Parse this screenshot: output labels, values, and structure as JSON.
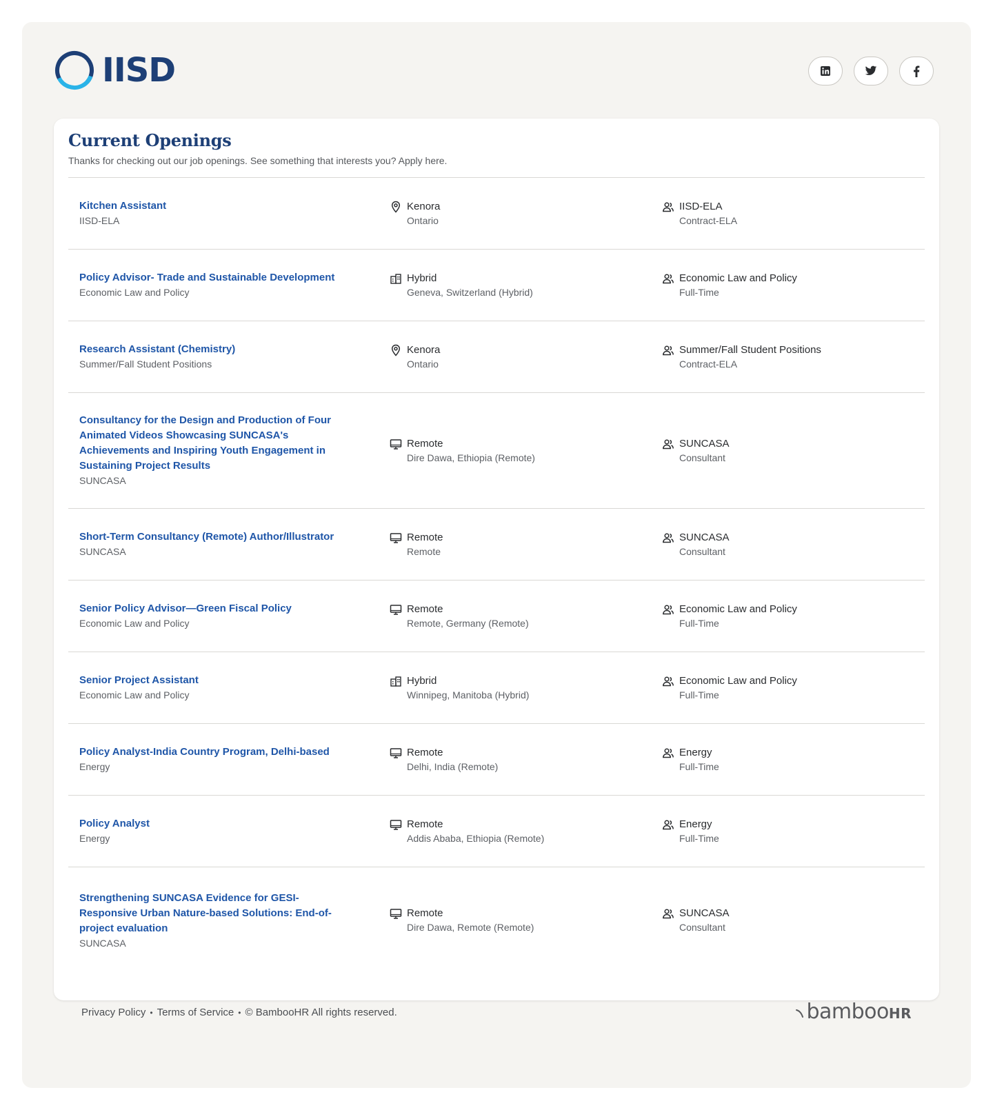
{
  "brand": {
    "name": "IISD"
  },
  "social": [
    {
      "name": "linkedin-icon"
    },
    {
      "name": "twitter-icon"
    },
    {
      "name": "facebook-icon"
    }
  ],
  "header": {
    "title": "Current Openings",
    "subtitle": "Thanks for checking out our job openings. See something that interests you? Apply here."
  },
  "jobs": [
    {
      "title_lines": [
        "Kitchen Assistant"
      ],
      "department": "IISD-ELA",
      "location_icon": "location-pin-icon",
      "location_type": "Kenora",
      "location_detail": "Ontario",
      "team": "IISD-ELA",
      "employment": "Contract-ELA"
    },
    {
      "title_lines": [
        "Policy Advisor- Trade and Sustainable Development"
      ],
      "department": "Economic Law and Policy",
      "location_icon": "hybrid-building-icon",
      "location_type": "Hybrid",
      "location_detail": "Geneva, Switzerland (Hybrid)",
      "team": "Economic Law and Policy",
      "employment": "Full-Time"
    },
    {
      "title_lines": [
        "Research Assistant (Chemistry)"
      ],
      "department": "Summer/Fall Student Positions",
      "location_icon": "location-pin-icon",
      "location_type": "Kenora",
      "location_detail": "Ontario",
      "team": "Summer/Fall Student Positions",
      "employment": "Contract-ELA"
    },
    {
      "title_lines": [
        "Consultancy for the Design and Production of Four",
        "Animated Videos Showcasing SUNCASA's",
        "Achievements and Inspiring Youth Engagement in",
        "Sustaining Project Results"
      ],
      "department": "SUNCASA",
      "location_icon": "remote-monitor-icon",
      "location_type": "Remote",
      "location_detail": "Dire Dawa, Ethiopia (Remote)",
      "team": "SUNCASA",
      "employment": "Consultant"
    },
    {
      "title_lines": [
        "Short-Term Consultancy (Remote) Author/Illustrator"
      ],
      "department": "SUNCASA",
      "location_icon": "remote-monitor-icon",
      "location_type": "Remote",
      "location_detail": "Remote",
      "team": "SUNCASA",
      "employment": "Consultant"
    },
    {
      "title_lines": [
        "Senior Policy Advisor—Green Fiscal Policy"
      ],
      "department": "Economic Law and Policy",
      "location_icon": "remote-monitor-icon",
      "location_type": "Remote",
      "location_detail": "Remote, Germany (Remote)",
      "team": "Economic Law and Policy",
      "employment": "Full-Time"
    },
    {
      "title_lines": [
        "Senior Project Assistant"
      ],
      "department": "Economic Law and Policy",
      "location_icon": "hybrid-building-icon",
      "location_type": "Hybrid",
      "location_detail": "Winnipeg, Manitoba (Hybrid)",
      "team": "Economic Law and Policy",
      "employment": "Full-Time"
    },
    {
      "title_lines": [
        "Policy Analyst-India Country Program, Delhi-based"
      ],
      "department": "Energy",
      "location_icon": "remote-monitor-icon",
      "location_type": "Remote",
      "location_detail": "Delhi, India (Remote)",
      "team": "Energy",
      "employment": "Full-Time"
    },
    {
      "title_lines": [
        "Policy Analyst"
      ],
      "department": "Energy",
      "location_icon": "remote-monitor-icon",
      "location_type": "Remote",
      "location_detail": "Addis Ababa, Ethiopia (Remote)",
      "team": "Energy",
      "employment": "Full-Time"
    },
    {
      "title_lines": [
        "Strengthening SUNCASA Evidence for GESI-",
        "Responsive Urban Nature-based Solutions: End-of-",
        "project evaluation"
      ],
      "department": "SUNCASA",
      "location_icon": "remote-monitor-icon",
      "location_type": "Remote",
      "location_detail": "Dire Dawa, Remote (Remote)",
      "team": "SUNCASA",
      "employment": "Consultant"
    }
  ],
  "footer": {
    "privacy": "Privacy Policy",
    "sep1": "•",
    "terms": "Terms of Service",
    "sep2": "•",
    "copyright": "© BambooHR All rights reserved.",
    "powered_main": "bamboo",
    "powered_hr": "HR"
  },
  "colors": {
    "brand_navy": "#1d3f76",
    "brand_cyan": "#2ab3e8",
    "link": "#1f56a8",
    "shell_bg": "#f5f4f1"
  }
}
